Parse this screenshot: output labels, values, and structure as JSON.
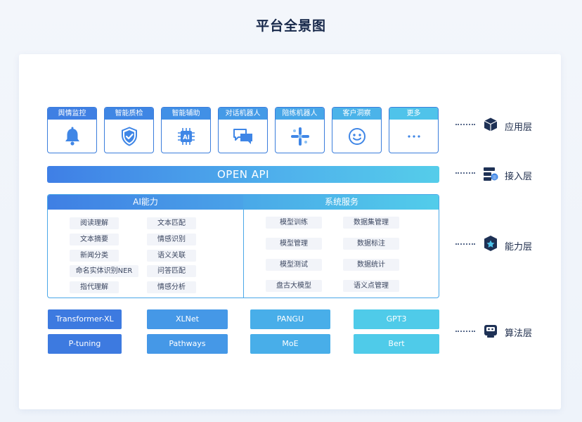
{
  "page": {
    "title": "平台全景图"
  },
  "apps": [
    {
      "label": "舆情监控",
      "icon": "bell-icon"
    },
    {
      "label": "智能质检",
      "icon": "shield-check-icon"
    },
    {
      "label": "智能辅助",
      "icon": "ai-chip-icon"
    },
    {
      "label": "对话机器人",
      "icon": "chat-bubbles-icon"
    },
    {
      "label": "陪练机器人",
      "icon": "pinwheel-icon"
    },
    {
      "label": "客户洞察",
      "icon": "smiley-icon"
    },
    {
      "label": "更多",
      "icon": "more-dots-icon"
    }
  ],
  "open_api": {
    "label": "OPEN API"
  },
  "capability": {
    "ai": {
      "title": "AI能力",
      "items": [
        "阅读理解",
        "文本匹配",
        "文本摘要",
        "情感识别",
        "新闻分类",
        "语义关联",
        "命名实体识别NER",
        "问答匹配",
        "指代理解",
        "情感分析"
      ]
    },
    "system": {
      "title": "系统服务",
      "items": [
        "模型训练",
        "数据集管理",
        "模型管理",
        "数据标注",
        "模型测试",
        "数据统计",
        "盘古大模型",
        "语义点管理"
      ]
    }
  },
  "algorithms": [
    "Transformer-XL",
    "XLNet",
    "PANGU",
    "GPT3",
    "P-tuning",
    "Pathways",
    "MoE",
    "Bert"
  ],
  "layers": [
    {
      "label": "应用层",
      "icon": "cube-icon"
    },
    {
      "label": "接入层",
      "icon": "api-access-icon"
    },
    {
      "label": "能力层",
      "icon": "star-shield-icon"
    },
    {
      "label": "算法层",
      "icon": "robot-icon"
    }
  ],
  "colors": {
    "primary": "#3a7ddc",
    "cyan": "#4fd0e8",
    "navy": "#17284a"
  }
}
